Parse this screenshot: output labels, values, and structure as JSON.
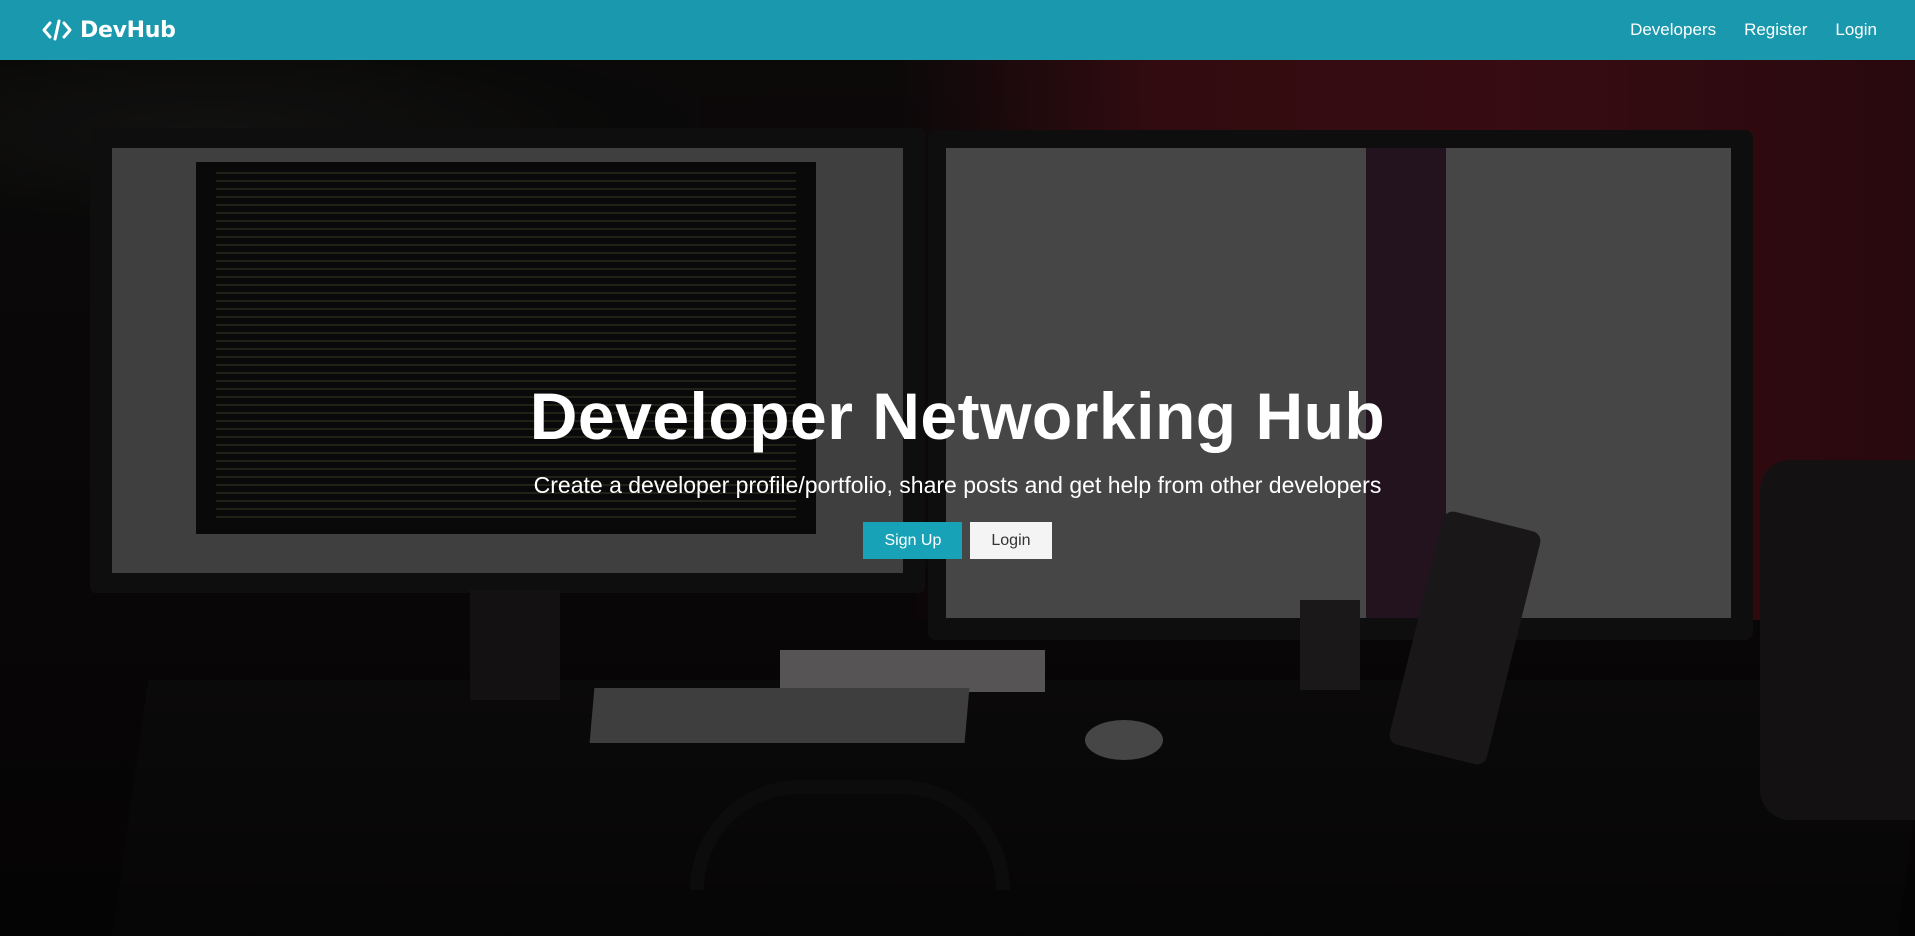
{
  "navbar": {
    "brand": "DevHub",
    "brand_icon": "code-icon",
    "links": [
      "Developers",
      "Register",
      "Login"
    ],
    "background_color": "#1a98ad"
  },
  "hero": {
    "title": "Developer Networking Hub",
    "lead": "Create a developer profile/portfolio, share posts and get help from other developers",
    "buttons": {
      "signup": "Sign Up",
      "login": "Login"
    },
    "primary_color": "#17a2b8"
  }
}
